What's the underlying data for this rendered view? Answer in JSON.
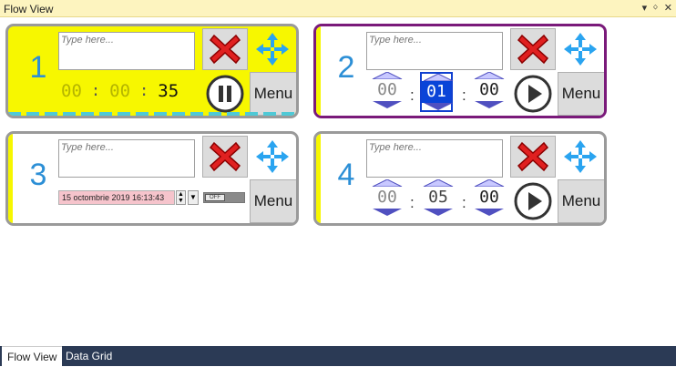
{
  "window": {
    "title": "Flow View",
    "controls": [
      "▾",
      "ᛜ",
      "✕"
    ]
  },
  "cards": [
    {
      "number": "1",
      "placeholder": "Type here...",
      "time": {
        "h": "00",
        "m": "00",
        "s": "35"
      },
      "menu": "Menu",
      "state": "running"
    },
    {
      "number": "2",
      "placeholder": "Type here...",
      "time": {
        "h": "00",
        "m": "01",
        "s": "00"
      },
      "menu": "Menu",
      "state": "paused"
    },
    {
      "number": "3",
      "placeholder": "Type here...",
      "date": "15 octombrie 2019 16:13:43",
      "toggle": "OFF",
      "menu": "Menu"
    },
    {
      "number": "4",
      "placeholder": "Type here...",
      "time": {
        "h": "00",
        "m": "05",
        "s": "00"
      },
      "menu": "Menu",
      "state": "paused"
    }
  ],
  "colors": {
    "accent": "#2c8fd6",
    "yellow": "#f7f700",
    "active_border": "#7a1a7a",
    "selected": "#0a44d8"
  },
  "tabs": [
    {
      "label": "Flow View",
      "active": true
    },
    {
      "label": "Data Grid",
      "active": false
    }
  ]
}
